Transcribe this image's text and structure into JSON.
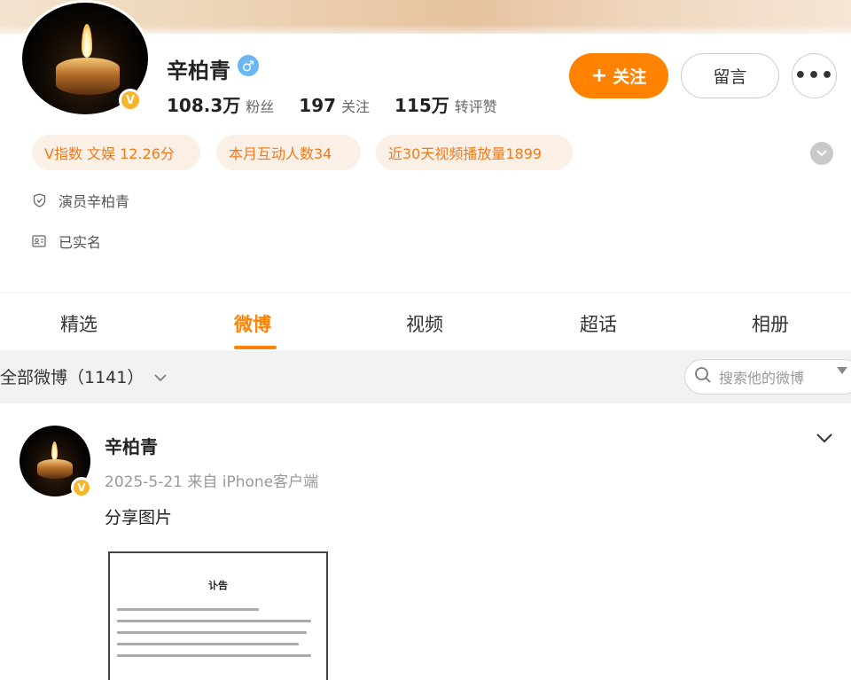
{
  "profile": {
    "name": "辛柏青",
    "verified_badge": "V",
    "stats": [
      {
        "value": "108.3万",
        "label": "粉丝"
      },
      {
        "value": "197",
        "label": "关注"
      },
      {
        "value": "115万",
        "label": "转评赞"
      }
    ],
    "follow_label": "关注",
    "message_label": "留言",
    "more_label": "•••",
    "tags": [
      "V指数 文娱 12.26分",
      "本月互动人数34",
      "近30天视频播放量1899"
    ],
    "info": [
      "演员辛柏青",
      "已实名"
    ]
  },
  "tabs": [
    "精选",
    "微博",
    "视频",
    "超话",
    "相册"
  ],
  "active_tab": "微博",
  "filter": {
    "label": "全部微博（1141）",
    "search_placeholder": "搜索他的微博"
  },
  "post": {
    "author": "辛柏青",
    "meta": "2025-5-21 来自 iPhone客户端",
    "text": "分享图片",
    "image_title": "讣告"
  },
  "colors": {
    "accent": "#ff8200",
    "tag_bg": "#fbf0e6",
    "tag_text": "#f07a1a",
    "verified": "#f7b52c",
    "gender": "#6cb6f2"
  },
  "icons": {
    "gender": "male-icon",
    "info": [
      "shield-icon",
      "id-card-icon"
    ],
    "search": "search-icon"
  }
}
